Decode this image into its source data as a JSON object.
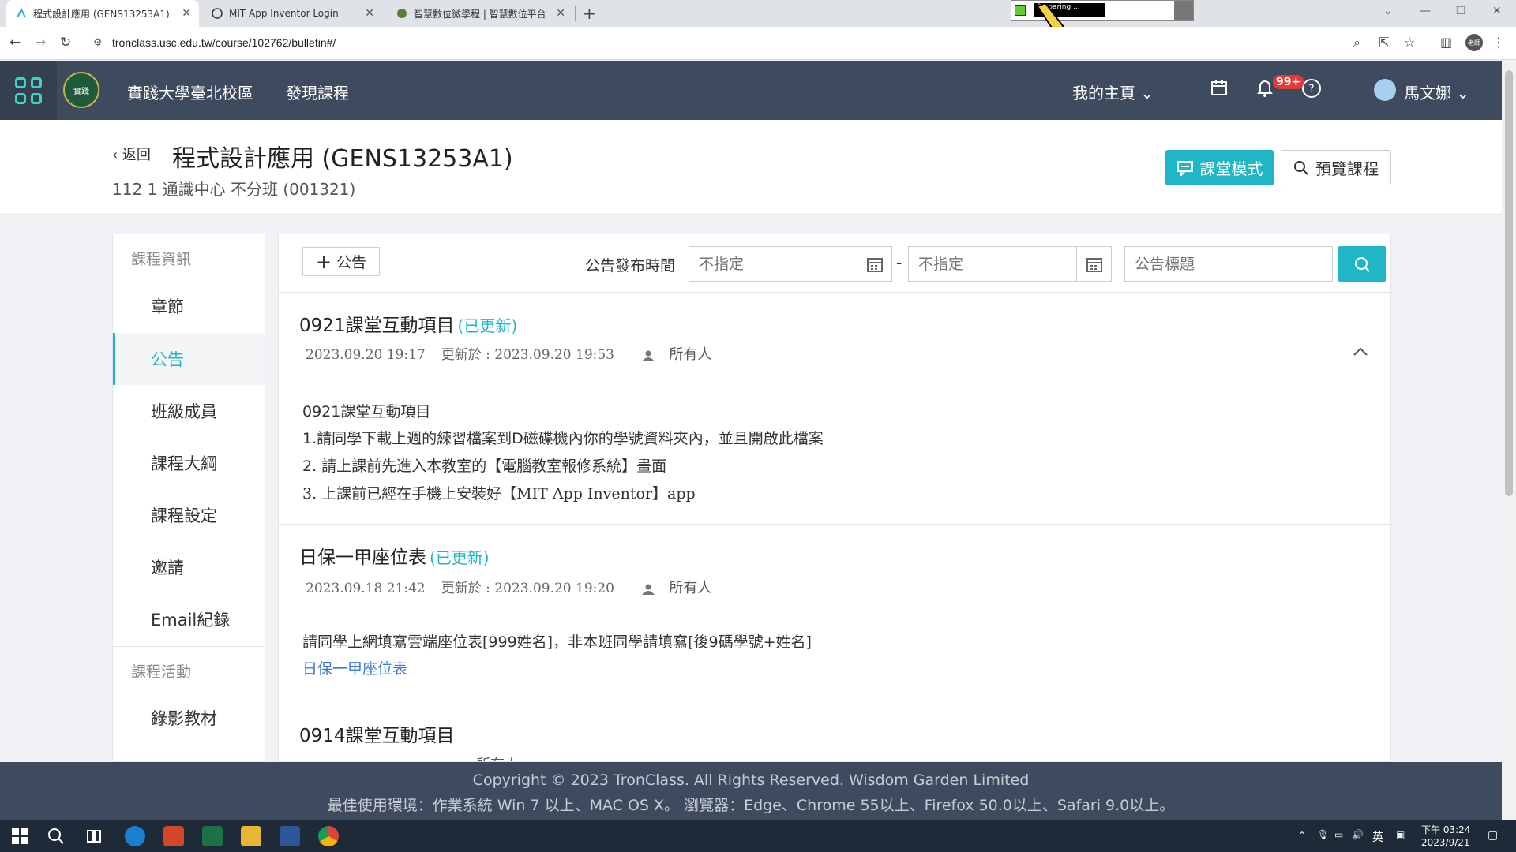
{
  "browser": {
    "tabs": [
      {
        "label": "程式設計應用 (GENS13253A1)",
        "active": true
      },
      {
        "label": "MIT App Inventor Login",
        "active": false
      },
      {
        "label": "智慧數位微學程 | 智慧數位平台",
        "active": false
      }
    ],
    "url": "tronclass.usc.edu.tw/course/102762/bulletin#/",
    "profile_initials": "老師",
    "overlay_text": "Preparing ..."
  },
  "header": {
    "school": "實踐大學臺北校區",
    "discover": "發現課程",
    "my_home": "我的主頁",
    "notification_badge": "99+",
    "user_name": "馬文娜",
    "logo_text": "實踐"
  },
  "course": {
    "back_label": "返回",
    "title": "程式設計應用 (GENS13253A1)",
    "subtitle": "112 1 通識中心 不分班 (001321)",
    "classroom_mode": "課堂模式",
    "preview_course": "預覽課程"
  },
  "sidebar": {
    "section_info": "課程資訊",
    "items": [
      {
        "label": "章節"
      },
      {
        "label": "公告"
      },
      {
        "label": "班級成員"
      },
      {
        "label": "課程大綱"
      },
      {
        "label": "課程設定"
      },
      {
        "label": "邀請"
      },
      {
        "label": "Email紀錄"
      }
    ],
    "section_activity": "課程活動",
    "activity_items": [
      {
        "label": "錄影教材"
      }
    ]
  },
  "toolbar": {
    "add_label": "公告",
    "time_label": "公告發布時間",
    "date_from_placeholder": "不指定",
    "date_to_placeholder": "不指定",
    "dash": "-",
    "title_placeholder": "公告標題"
  },
  "posts": [
    {
      "title": "0921課堂互動項目",
      "updated": "(已更新)",
      "created": "2023.09.20 19:17",
      "updated_at": "更新於 : 2023.09.20 19:53",
      "audience": "所有人",
      "lines": [
        "0921課堂互動項目",
        "1.請同學下載上週的練習檔案到D磁碟機內你的學號資料夾內，並且開啟此檔案",
        "2. 請上課前先進入本教室的【電腦教室報修系統】畫面",
        "3. 上課前已經在手機上安裝好【MIT App Inventor】app"
      ]
    },
    {
      "title": "日保一甲座位表",
      "updated": "(已更新)",
      "created": "2023.09.18 21:42",
      "updated_at": "更新於 : 2023.09.20 19:20",
      "audience": "所有人",
      "lines": [
        "請同學上網填寫雲端座位表[999姓名]，非本班同學請填寫[後9碼學號+姓名]"
      ],
      "link": "日保一甲座位表"
    },
    {
      "title": "0914課堂互動項目",
      "audience": "所有人"
    }
  ],
  "footer": {
    "copyright": "Copyright © 2023 TronClass. All Rights Reserved. Wisdom Garden Limited",
    "env": "最佳使用環境：作業系統 Win 7 以上、MAC OS X。 瀏覽器：Edge、Chrome 55以上、Firefox 50.0以上、Safari 9.0以上。"
  },
  "taskbar": {
    "ime": "英",
    "time": "下午 03:24",
    "date": "2023/9/21"
  }
}
